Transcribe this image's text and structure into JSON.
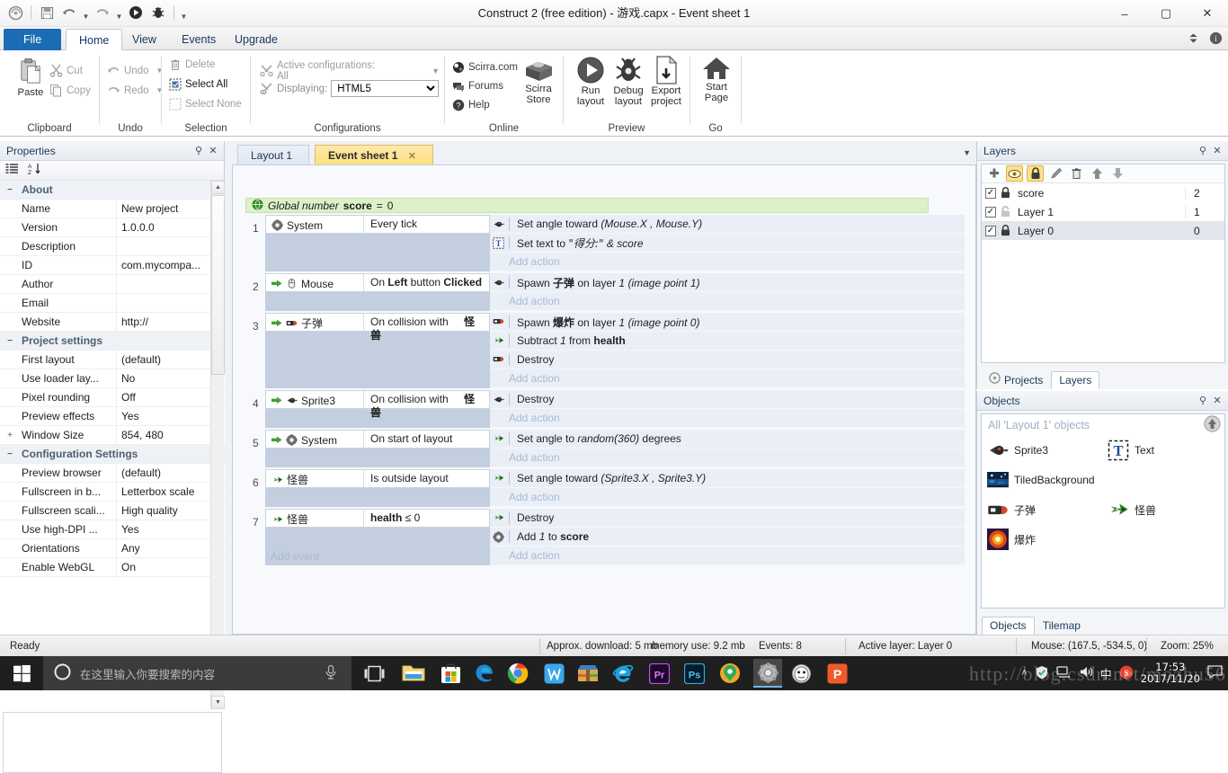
{
  "window": {
    "title": "Construct 2  (free edition) - 游戏.capx - Event sheet 1",
    "minimize": "–",
    "maximize": "▢",
    "close": "✕"
  },
  "quick_access": {
    "icons": [
      "construct-logo-icon",
      "save-icon",
      "undo-icon",
      "redo-icon",
      "run-icon",
      "debug-icon",
      "customize-icon"
    ]
  },
  "ribbon_tabs": [
    {
      "label": "File",
      "active": false
    },
    {
      "label": "Home",
      "active": true
    },
    {
      "label": "View",
      "active": false
    },
    {
      "label": "Events",
      "active": false
    },
    {
      "label": "Upgrade",
      "active": false
    }
  ],
  "ribbon": {
    "clipboard": {
      "group_label": "Clipboard",
      "paste": "Paste",
      "cut": "Cut",
      "copy": "Copy"
    },
    "undo": {
      "group_label": "Undo",
      "undo": "Undo",
      "redo": "Redo"
    },
    "selection": {
      "group_label": "Selection",
      "delete": "Delete",
      "select_all": "Select All",
      "select_none": "Select None"
    },
    "configurations": {
      "group_label": "Configurations",
      "active_configurations": "Active configurations: All",
      "displaying_label": "Displaying:",
      "displaying_value": "HTML5",
      "displaying_options": [
        "HTML5"
      ]
    },
    "online": {
      "group_label": "Online",
      "scirra_com": "Scirra.com",
      "forums": "Forums",
      "help": "Help",
      "store_line1": "Scirra",
      "store_line2": "Store"
    },
    "preview": {
      "group_label": "Preview",
      "run_line1": "Run",
      "run_line2": "layout",
      "debug_line1": "Debug",
      "debug_line2": "layout",
      "export_line1": "Export",
      "export_line2": "project"
    },
    "go": {
      "group_label": "Go",
      "start_line1": "Start",
      "start_line2": "Page"
    }
  },
  "properties": {
    "title": "Properties",
    "groups": [
      {
        "name": "About",
        "expander": "−",
        "rows": [
          {
            "name": "Name",
            "value": "New project"
          },
          {
            "name": "Version",
            "value": "1.0.0.0"
          },
          {
            "name": "Description",
            "value": ""
          },
          {
            "name": "ID",
            "value": "com.mycompa..."
          },
          {
            "name": "Author",
            "value": ""
          },
          {
            "name": "Email",
            "value": ""
          },
          {
            "name": "Website",
            "value": "http://"
          }
        ]
      },
      {
        "name": "Project settings",
        "expander": "−",
        "rows": [
          {
            "name": "First layout",
            "value": "(default)"
          },
          {
            "name": "Use loader lay...",
            "value": "No"
          },
          {
            "name": "Pixel rounding",
            "value": "Off"
          },
          {
            "name": "Preview effects",
            "value": "Yes"
          },
          {
            "name": "Window Size",
            "value": "854, 480",
            "expander": "+"
          }
        ]
      },
      {
        "name": "Configuration Settings",
        "expander": "−",
        "rows": [
          {
            "name": "Preview browser",
            "value": "(default)"
          },
          {
            "name": "Fullscreen in b...",
            "value": "Letterbox scale"
          },
          {
            "name": "Fullscreen scali...",
            "value": "High quality"
          },
          {
            "name": "Use high-DPI ...",
            "value": "Yes"
          },
          {
            "name": "Orientations",
            "value": "Any"
          },
          {
            "name": "Enable WebGL",
            "value": "On"
          }
        ]
      }
    ]
  },
  "editor": {
    "tabs": [
      {
        "label": "Layout 1",
        "active": false,
        "closable": false
      },
      {
        "label": "Event sheet 1",
        "active": true,
        "closable": true,
        "close": "✕"
      }
    ],
    "global_variable": {
      "prefix": "Global number",
      "name": "score",
      "equals": "=",
      "value": "0",
      "icon": "global-variable-icon"
    },
    "add_event": "Add event",
    "add_action": "Add action",
    "events": [
      {
        "number": "1",
        "object": "System",
        "object_icon": "system-icon",
        "arrow": false,
        "condition": "Every tick",
        "actions": [
          {
            "icon": "sprite3-icon",
            "text": "Set angle toward (Mouse.X , Mouse.Y)"
          },
          {
            "icon": "text-object-icon",
            "text": "Set text to \"得分:\" & score"
          }
        ]
      },
      {
        "number": "2",
        "object": "Mouse",
        "object_icon": "mouse-icon",
        "arrow": true,
        "condition": "On Left button Clicked",
        "actions": [
          {
            "icon": "sprite3-icon",
            "text": "Spawn 子弹 on layer 1 (image point 1)"
          }
        ]
      },
      {
        "number": "3",
        "object": "子弹",
        "object_icon": "bullet-icon",
        "arrow": true,
        "condition": "On collision with 怪兽",
        "actions": [
          {
            "icon": "bullet-icon",
            "text": "Spawn 爆炸 on layer 1 (image point 0)"
          },
          {
            "icon": "monster-icon",
            "text": "Subtract 1 from health"
          },
          {
            "icon": "bullet-icon",
            "text": "Destroy"
          }
        ]
      },
      {
        "number": "4",
        "object": "Sprite3",
        "object_icon": "sprite3-icon",
        "arrow": true,
        "condition": "On collision with 怪兽",
        "actions": [
          {
            "icon": "sprite3-icon",
            "text": "Destroy"
          }
        ]
      },
      {
        "number": "5",
        "object": "System",
        "object_icon": "system-icon",
        "arrow": true,
        "condition": "On start of layout",
        "actions": [
          {
            "icon": "monster-icon",
            "text": "Set angle to random(360) degrees"
          }
        ]
      },
      {
        "number": "6",
        "object": "怪兽",
        "object_icon": "monster-icon",
        "arrow": false,
        "condition": "Is outside layout",
        "actions": [
          {
            "icon": "monster-icon",
            "text": "Set angle toward (Sprite3.X , Sprite3.Y)"
          }
        ]
      },
      {
        "number": "7",
        "object": "怪兽",
        "object_icon": "monster-icon",
        "arrow": false,
        "condition": "health ≤ 0",
        "actions": [
          {
            "icon": "monster-icon",
            "text": "Destroy"
          },
          {
            "icon": "system-icon",
            "text": "Add 1 to score"
          }
        ]
      }
    ]
  },
  "layers_panel": {
    "title": "Layers",
    "toolbar_icons": [
      "add-layer-icon",
      "toggle-visibility-icon",
      "toggle-lock-icon",
      "rename-layer-icon",
      "delete-layer-icon",
      "move-up-icon",
      "move-down-icon"
    ],
    "rows": [
      {
        "checked": true,
        "locked": true,
        "name": "score",
        "index": "2",
        "selected": false
      },
      {
        "checked": true,
        "locked": false,
        "name": "Layer 1",
        "index": "1",
        "selected": false
      },
      {
        "checked": true,
        "locked": true,
        "name": "Layer 0",
        "index": "0",
        "selected": true
      }
    ],
    "dock_tabs": [
      {
        "label": "Projects",
        "active": false
      },
      {
        "label": "Layers",
        "active": true
      }
    ]
  },
  "objects_panel": {
    "title": "Objects",
    "header": "All 'Layout 1' objects",
    "up_button": "up-folder-icon",
    "items": [
      {
        "name": "Sprite3",
        "icon": "sprite3-icon",
        "col": 0,
        "row": 0
      },
      {
        "name": "Text",
        "icon": "text-object-icon",
        "col": 1,
        "row": 0
      },
      {
        "name": "TiledBackground",
        "icon": "tiledbackground-icon",
        "col": 0,
        "row": 1
      },
      {
        "name": "子弹",
        "icon": "bullet-icon",
        "col": 0,
        "row": 2
      },
      {
        "name": "怪兽",
        "icon": "monster-icon",
        "col": 1,
        "row": 2
      },
      {
        "name": "爆炸",
        "icon": "explosion-icon",
        "col": 0,
        "row": 3
      }
    ],
    "dock_tabs": [
      {
        "label": "Objects",
        "active": true
      },
      {
        "label": "Tilemap",
        "active": false
      }
    ]
  },
  "statusbar": {
    "ready": "Ready",
    "download": "Approx. download: 5 mb",
    "memory": "memory use: 9.2 mb",
    "events": "Events: 8",
    "active_layer": "Active layer: Layer 0",
    "mouse": "Mouse: (167.5, -534.5, 0)",
    "zoom": "Zoom: 25%"
  },
  "taskbar": {
    "start": "start-icon",
    "search_placeholder": "在这里输入你要搜索的内容",
    "cortana_icon": "cortana-circle-icon",
    "mic_icon": "microphone-icon",
    "taskview_icon": "task-view-icon",
    "pinned": [
      "file-explorer-icon",
      "microsoft-store-icon",
      "edge-icon",
      "chrome-icon",
      "wps-icon",
      "winrar-icon",
      "internet-explorer-icon",
      "premiere-icon",
      "photoshop-icon",
      "360-browser-icon",
      "construct2-icon",
      "qq-icon",
      "wps-presentation-icon"
    ],
    "tray_icons": [
      "show-hidden-icon",
      "security-icon",
      "network-icon",
      "volume-icon",
      "ime-icon",
      "sogou-icon",
      "notification-icon"
    ],
    "ime_label": "中",
    "time": "17:53",
    "date": "2017/11/20"
  },
  "watermark": "http://blog.csdn.net/mozhu56"
}
